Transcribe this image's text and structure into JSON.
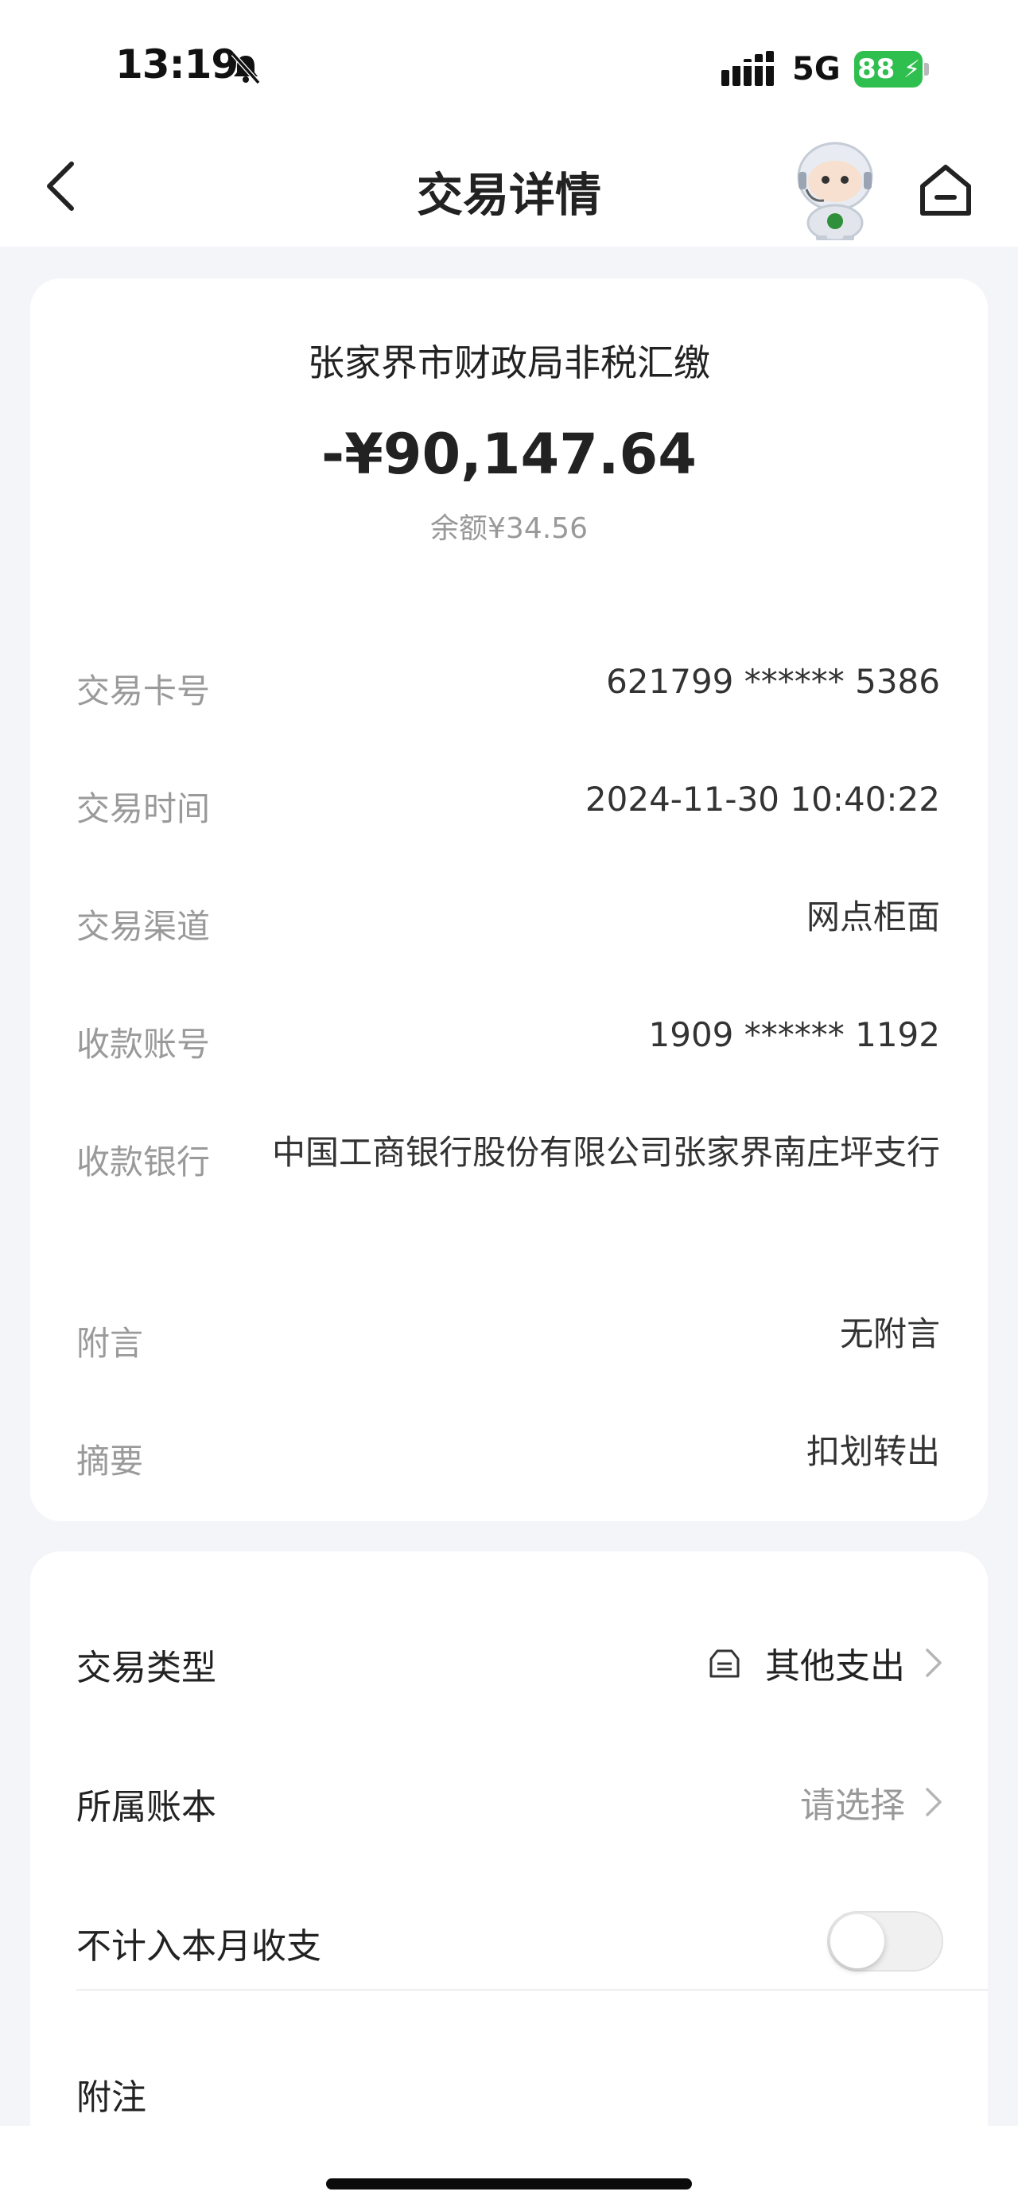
{
  "status_bar": {
    "time": "13:19",
    "network": "5G",
    "battery": "88"
  },
  "nav": {
    "title": "交易详情"
  },
  "summary": {
    "merchant": "张家界市财政局非税汇缴",
    "amount": "-¥90,147.64",
    "balance": "余额¥34.56"
  },
  "details": [
    {
      "label": "交易卡号",
      "value": "621799 ****** 5386"
    },
    {
      "label": "交易时间",
      "value": "2024-11-30 10:40:22"
    },
    {
      "label": "交易渠道",
      "value": "网点柜面"
    },
    {
      "label": "收款账号",
      "value": "1909 ****** 1192"
    },
    {
      "label": "收款银行",
      "value": "中国工商银行股份有限公司张家界南庄坪支行"
    },
    {
      "label": "附言",
      "value": "无附言"
    },
    {
      "label": "摘要",
      "value": "扣划转出"
    }
  ],
  "settings": {
    "type": {
      "label": "交易类型",
      "value": "其他支出"
    },
    "ledger": {
      "label": "所属账本",
      "placeholder": "请选择"
    },
    "exclude": {
      "label": "不计入本月收支",
      "enabled": false
    },
    "note": {
      "label": "附注"
    }
  },
  "colors": {
    "battery": "#2fbf4e",
    "muted": "#999999",
    "background": "#f4f5f8"
  }
}
